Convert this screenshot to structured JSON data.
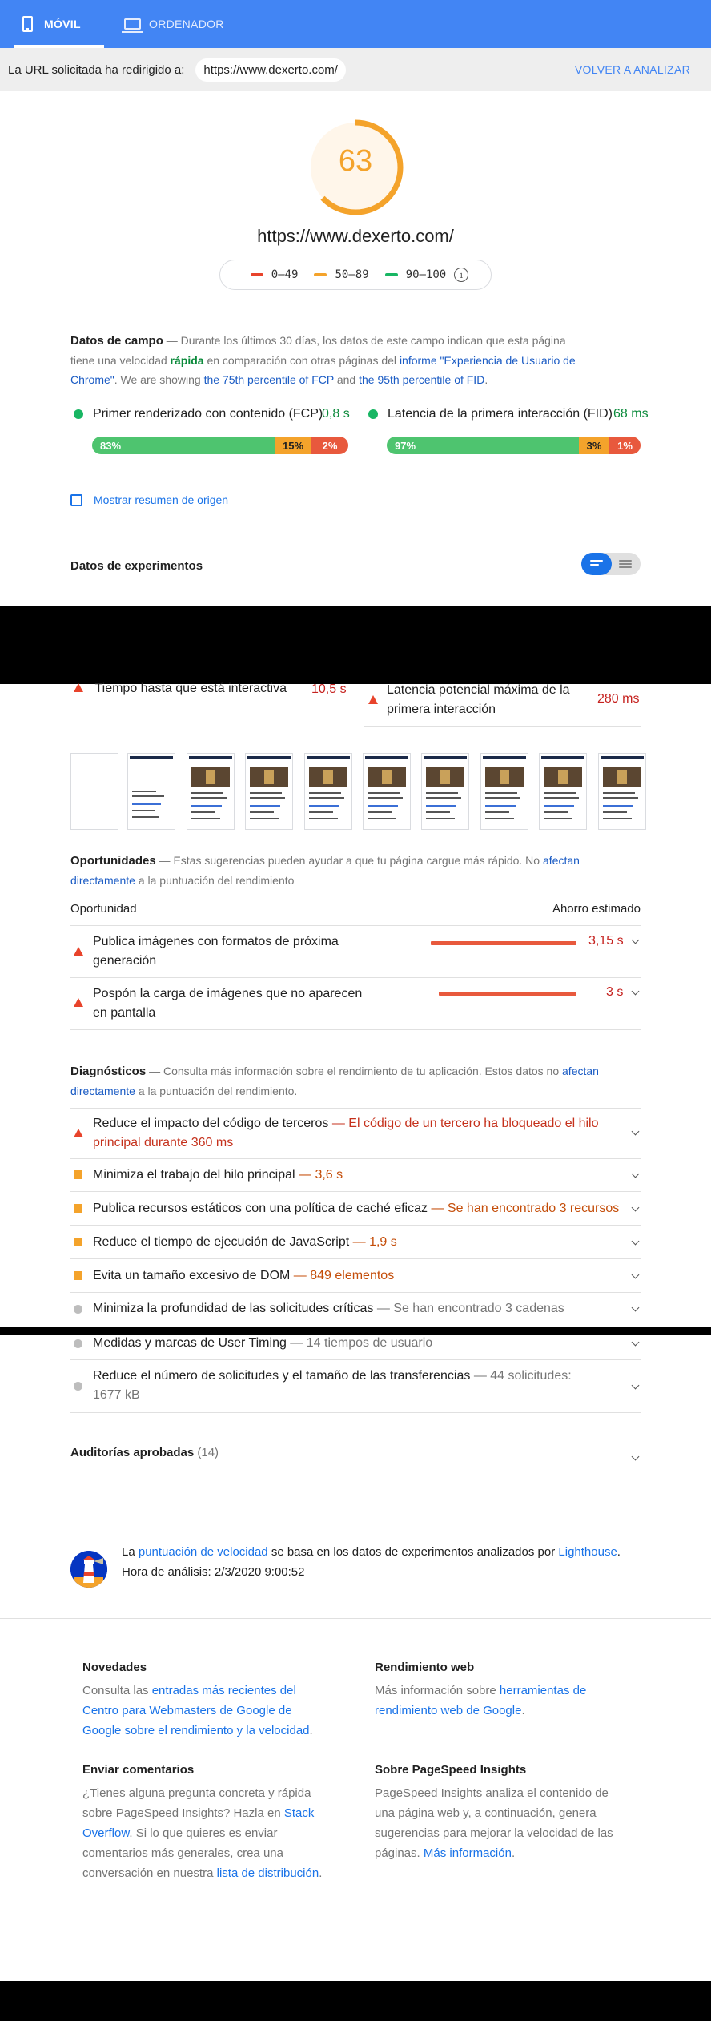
{
  "tabs": {
    "mobile": "MÓVIL",
    "desktop": "ORDENADOR"
  },
  "redirect": {
    "label": "La URL solicitada ha redirigido a:",
    "url": "https://www.dexerto.com/",
    "reanalyze": "VOLVER A ANALIZAR"
  },
  "score": {
    "value": "63",
    "fraction": 0.63,
    "color": "#f4a32b",
    "url": "https://www.dexerto.com/"
  },
  "legend": [
    {
      "range": "0–49",
      "color": "#e8432b"
    },
    {
      "range": "50–89",
      "color": "#f4a32b"
    },
    {
      "range": "90–100",
      "color": "#18b663"
    }
  ],
  "field": {
    "title": "Datos de campo",
    "desc_1": " — Durante los últimos 30 días, los datos de este campo indican que esta página tiene una velocidad ",
    "speed": "rápida",
    "desc_2": " en comparación con otras páginas del ",
    "report_link": "informe \"Experiencia de Usuario de Chrome\"",
    "desc_3": ". We are showing ",
    "fcp_link": "the 75th percentile of FCP",
    "desc_4": " and ",
    "fid_link": "the 95th percentile of FID",
    "desc_5": ".",
    "fcp": {
      "label": "Primer renderizado con contenido (FCP)",
      "value": "0,8 s",
      "dist": [
        "83%",
        "15%",
        "2%"
      ]
    },
    "fid": {
      "label": "Latencia de la primera interacción (FID)",
      "value": "68 ms",
      "dist": [
        "97%",
        "3%",
        "1%"
      ]
    },
    "origin_summary": "Mostrar resumen de origen"
  },
  "lab": {
    "title": "Datos de experimentos",
    "tti": {
      "label": "Tiempo hasta que está interactiva",
      "value": "10,5 s"
    },
    "max_fid": {
      "label": "Latencia potencial máxima de la primera interacción",
      "value": "280 ms"
    }
  },
  "opportunities": {
    "title": "Oportunidades",
    "desc_1": " — Estas sugerencias pueden ayudar a que tu página cargue más rápido. No ",
    "link": "afectan directamente",
    "desc_2": " a la puntuación del rendimiento",
    "col_opportunity": "Oportunidad",
    "col_savings": "Ahorro estimado",
    "items": [
      {
        "title": "Publica imágenes con formatos de próxima generación",
        "value": "3,15 s"
      },
      {
        "title": "Pospón la carga de imágenes que no aparecen en pantalla",
        "value": "3 s"
      }
    ]
  },
  "diagnostics": {
    "title": "Diagnósticos",
    "desc_1": " — Consulta más información sobre el rendimiento de tu aplicación. Estos datos no ",
    "link": "afectan directamente",
    "desc_2": " a la puntuación del rendimiento.",
    "items": [
      {
        "title": "Reduce el impacto del código de terceros",
        "detail": " — El código de un tercero ha bloqueado el hilo principal durante 360 ms"
      },
      {
        "title": "Minimiza el trabajo del hilo principal",
        "detail": " — 3,6 s"
      },
      {
        "title": "Publica recursos estáticos con una política de caché eficaz",
        "detail": " — Se han encontrado 3 recursos"
      },
      {
        "title": "Reduce el tiempo de ejecución de JavaScript",
        "detail": " — 1,9 s"
      },
      {
        "title": "Evita un tamaño excesivo de DOM",
        "detail": " — 849 elementos"
      },
      {
        "title": "Minimiza la profundidad de las solicitudes críticas",
        "detail": " — Se han encontrado 3 cadenas"
      },
      {
        "title": "Medidas y marcas de User Timing",
        "detail": " — 14 tiempos de usuario"
      },
      {
        "title": "Reduce el número de solicitudes y el tamaño de las transferencias",
        "detail": " — 44 solicitudes: 1677 kB"
      }
    ]
  },
  "passed": {
    "label": "Auditorías aprobadas",
    "count": "(14)"
  },
  "lighthouse": {
    "pre": "La ",
    "link": "puntuación de velocidad",
    "mid": " se basa en los datos de experimentos analizados por ",
    "lh_link": "Lighthouse",
    "post": ".",
    "time": "Hora de análisis: 2/3/2020 9:00:52"
  },
  "footer": {
    "news": {
      "title": "Novedades",
      "pre": "Consulta las ",
      "link": "entradas más recientes del Centro para Webmasters de Google de Google sobre el rendimiento y la velocidad",
      "post": "."
    },
    "web": {
      "title": "Rendimiento web",
      "pre": "Más información sobre ",
      "link": "herramientas de rendimiento web de Google",
      "post": "."
    },
    "feedback": {
      "title": "Enviar comentarios",
      "pre": "¿Tienes alguna pregunta concreta y rápida sobre PageSpeed Insights? Hazla en ",
      "link1": "Stack Overflow",
      "mid": ". Si lo que quieres es enviar comentarios más generales, crea una conversación en nuestra ",
      "link2": "lista de distribución",
      "post": "."
    },
    "about": {
      "title": "Sobre PageSpeed Insights",
      "pre": "PageSpeed Insights analiza el contenido de una página web y, a continuación, genera sugerencias para mejorar la velocidad de las páginas. ",
      "link": "Más información",
      "post": "."
    }
  }
}
